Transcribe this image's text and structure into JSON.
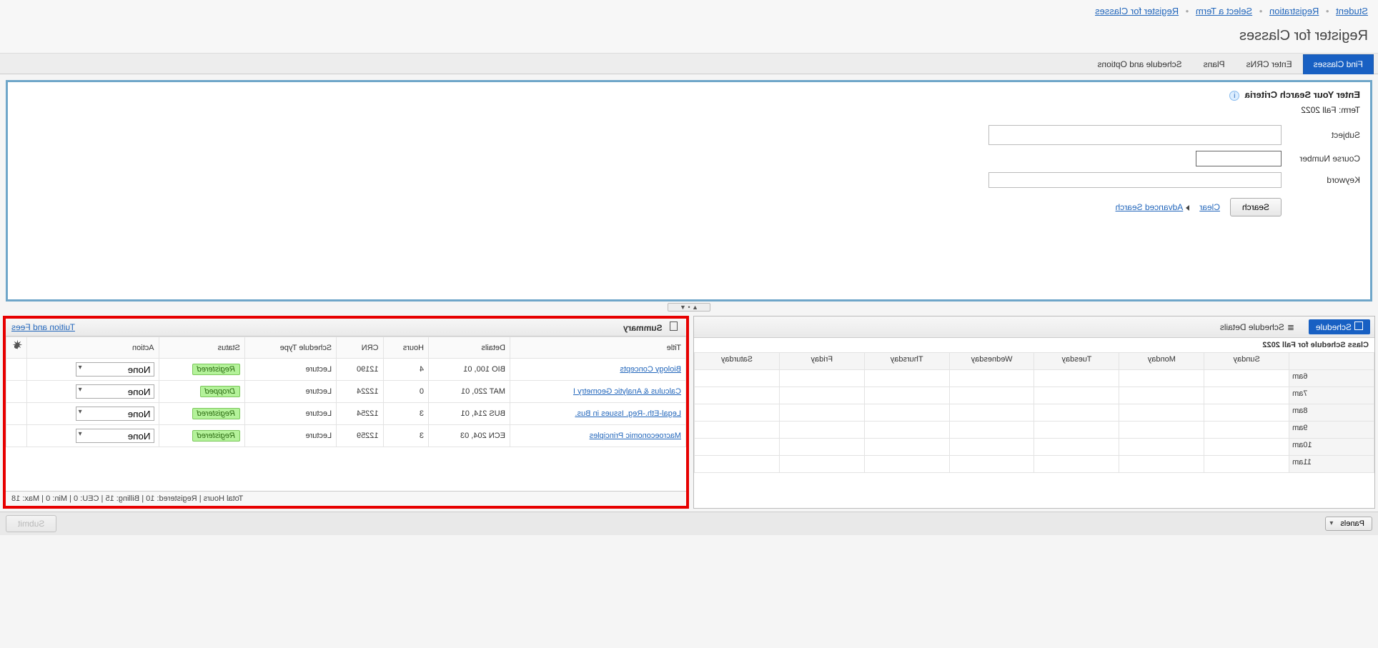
{
  "breadcrumb": [
    "Student",
    "Registration",
    "Select a Term",
    "Register for Classes"
  ],
  "page_title": "Register for Classes",
  "tabs": [
    "Find Classes",
    "Enter CRNs",
    "Plans",
    "Schedule and Options"
  ],
  "active_tab": 0,
  "search": {
    "header": "Enter Your Search Criteria",
    "term_label": "Term: Fall 2022",
    "subject_label": "Subject",
    "course_number_label": "Course Number",
    "keyword_label": "Keyword",
    "search_btn": "Search",
    "clear_link": "Clear",
    "advanced_link": "Advanced Search"
  },
  "schedule_panel": {
    "tab_schedule": "Schedule",
    "tab_details": "Schedule Details",
    "subtitle": "Class Schedule for Fall 2022",
    "days": [
      "Sunday",
      "Monday",
      "Tuesday",
      "Wednesday",
      "Thursday",
      "Friday",
      "Saturday"
    ],
    "hours": [
      "6am",
      "7am",
      "8am",
      "9am",
      "10am",
      "11am"
    ]
  },
  "summary_panel": {
    "title": "Summary",
    "tuition_link": "Tuition and Fees",
    "columns": [
      "Title",
      "Details",
      "Hours",
      "CRN",
      "Schedule Type",
      "Status",
      "Action"
    ],
    "gear_col": "",
    "rows": [
      {
        "title": "Biology Concepts",
        "details": "BIO 100, 01",
        "hours": "4",
        "crn": "12190",
        "type": "Lecture",
        "status": "Registered",
        "action": "None"
      },
      {
        "title": "Calculus & Analytic Geometry I",
        "details": "MAT 220, 01",
        "hours": "0",
        "crn": "12224",
        "type": "Lecture",
        "status": "Dropped",
        "action": "None"
      },
      {
        "title": "Legal-Eth.-Reg. Issues in Bus.",
        "details": "BUS 214, 01",
        "hours": "3",
        "crn": "12254",
        "type": "Lecture",
        "status": "Registered",
        "action": "None"
      },
      {
        "title": "Macroeconomic Principles",
        "details": "ECN 204, 03",
        "hours": "3",
        "crn": "12259",
        "type": "Lecture",
        "status": "Registered",
        "action": "None"
      }
    ],
    "totals": "Total Hours | Registered: 10 | Billing: 15 | CEU: 0 | Min: 0 | Max: 18"
  },
  "footer": {
    "panels_btn": "Panels",
    "submit_btn": "Submit"
  }
}
